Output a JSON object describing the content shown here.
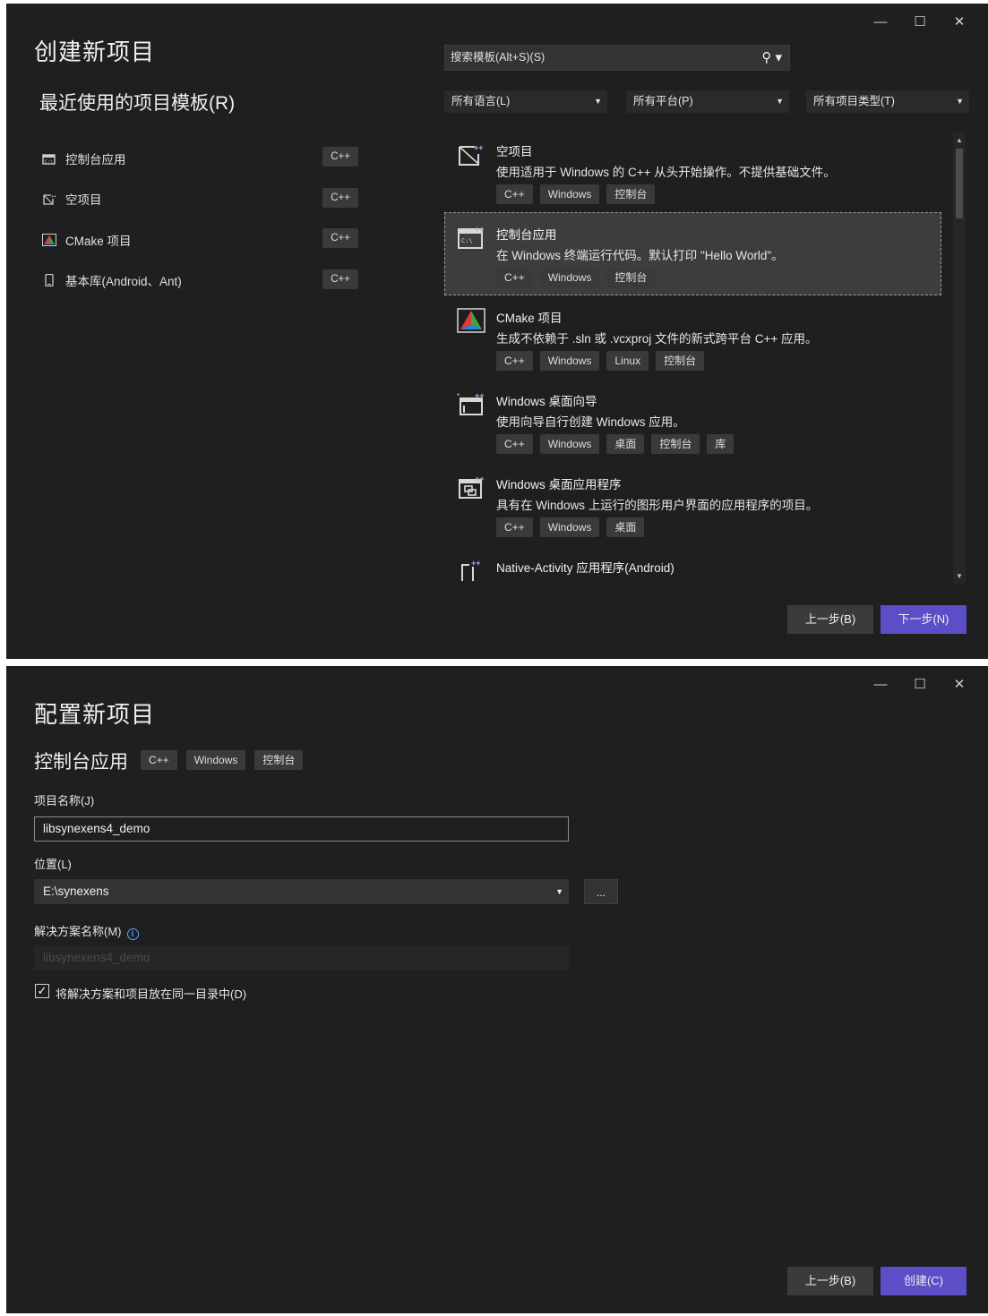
{
  "window_controls": {
    "minimize": "—",
    "maximize": "☐",
    "close": "✕"
  },
  "create": {
    "title": "创建新项目",
    "recent_title": "最近使用的项目模板(R)",
    "recent": [
      {
        "label": "控制台应用",
        "lang": "C++",
        "icon": "console-app-icon"
      },
      {
        "label": "空项目",
        "lang": "C++",
        "icon": "empty-project-icon"
      },
      {
        "label": "CMake 项目",
        "lang": "C++",
        "icon": "cmake-icon"
      },
      {
        "label": "基本库(Android、Ant)",
        "lang": "C++",
        "icon": "android-library-icon"
      }
    ],
    "search_placeholder": "搜索模板(Alt+S)(S)",
    "filters": {
      "language": "所有语言(L)",
      "platform": "所有平台(P)",
      "project_type": "所有项目类型(T)"
    },
    "templates": [
      {
        "name": "空项目",
        "desc": "使用适用于 Windows 的 C++ 从头开始操作。不提供基础文件。",
        "tags": [
          "C++",
          "Windows",
          "控制台"
        ],
        "icon": "empty-project-icon"
      },
      {
        "name": "控制台应用",
        "desc": "在 Windows 终端运行代码。默认打印 \"Hello World\"。",
        "tags": [
          "C++",
          "Windows",
          "控制台"
        ],
        "icon": "console-app-icon",
        "selected": true
      },
      {
        "name": "CMake 项目",
        "desc": "生成不依赖于 .sln 或 .vcxproj 文件的新式跨平台 C++ 应用。",
        "tags": [
          "C++",
          "Windows",
          "Linux",
          "控制台"
        ],
        "icon": "cmake-icon"
      },
      {
        "name": "Windows 桌面向导",
        "desc": "使用向导自行创建 Windows 应用。",
        "tags": [
          "C++",
          "Windows",
          "桌面",
          "控制台",
          "库"
        ],
        "icon": "desktop-wizard-icon"
      },
      {
        "name": "Windows 桌面应用程序",
        "desc": "具有在 Windows 上运行的图形用户界面的应用程序的项目。",
        "tags": [
          "C++",
          "Windows",
          "桌面"
        ],
        "icon": "desktop-app-icon"
      },
      {
        "name": "Native-Activity 应用程序(Android)",
        "desc": "",
        "tags": [],
        "icon": "native-activity-icon"
      }
    ],
    "back_label": "上一步(B)",
    "next_label": "下一步(N)"
  },
  "configure": {
    "title": "配置新项目",
    "template_name": "控制台应用",
    "tags": [
      "C++",
      "Windows",
      "控制台"
    ],
    "project_name_label": "项目名称(J)",
    "project_name_value": "libsynexens4_demo",
    "location_label": "位置(L)",
    "location_value": "E:\\synexens",
    "browse_label": "...",
    "solution_name_label": "解决方案名称(M)",
    "solution_name_value": "libsynexens4_demo",
    "same_dir_label": "将解决方案和项目放在同一目录中(D)",
    "same_dir_checked": true,
    "back_label": "上一步(B)",
    "create_label": "创建(C)"
  },
  "colors": {
    "background": "#1f1f1f",
    "primary_button": "#5b4ec7",
    "tag_bg": "#3a3a3a"
  }
}
